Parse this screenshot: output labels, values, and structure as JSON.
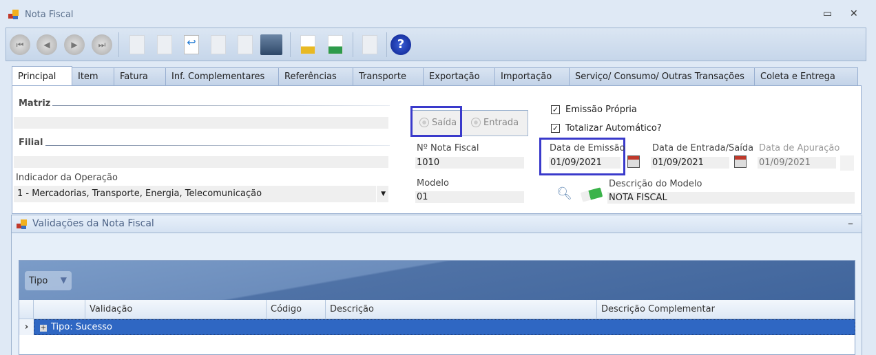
{
  "window": {
    "title": "Nota Fiscal",
    "minimize": "▭",
    "close": "✕"
  },
  "toolbar": {
    "items": [
      "first-icon",
      "previous-icon",
      "next-icon",
      "last-icon",
      "new-icon",
      "edit-icon",
      "undo-icon",
      "delete-icon",
      "redo-icon",
      "save-icon",
      "report-coins-icon",
      "report-sum-icon",
      "lock-icon",
      "help-icon"
    ],
    "help": "?"
  },
  "tabs": [
    "Principal",
    "Item",
    "Fatura",
    "Inf. Complementares",
    "Referências",
    "Transporte",
    "Exportação",
    "Importação",
    "Serviço/ Consumo/ Outras Transações",
    "Coleta e Entrega"
  ],
  "principal": {
    "matriz": "Matriz",
    "filial": "Filial",
    "indicador_label": "Indicador da Operação",
    "indicador_value": "1 - Mercadorias, Transporte, Energia, Telecomunicação",
    "saida": "Saída",
    "entrada": "Entrada",
    "emissao_propria": "Emissão Própria",
    "totalizar": "Totalizar Automático?",
    "nf_label": "Nº Nota Fiscal",
    "nf_value": "1010",
    "modelo_label": "Modelo",
    "modelo_value": "01",
    "data_emissao_label": "Data de Emissão",
    "data_emissao": "01/09/2021",
    "data_entrada_label": "Data de Entrada/Saída",
    "data_entrada": "01/09/2021",
    "data_apuracao_label": "Data de Apuração",
    "data_apuracao": "01/09/2021",
    "desc_modelo_label": "Descrição do Modelo",
    "desc_modelo": "NOTA FISCAL"
  },
  "validacoes": {
    "title": "Validações da Nota Fiscal",
    "collapse": "–",
    "group_button": "Tipo",
    "columns": [
      "Validação",
      "Código",
      "Descrição",
      "Descrição Complementar"
    ],
    "rows": [
      {
        "label": "Tipo: Sucesso"
      }
    ]
  }
}
